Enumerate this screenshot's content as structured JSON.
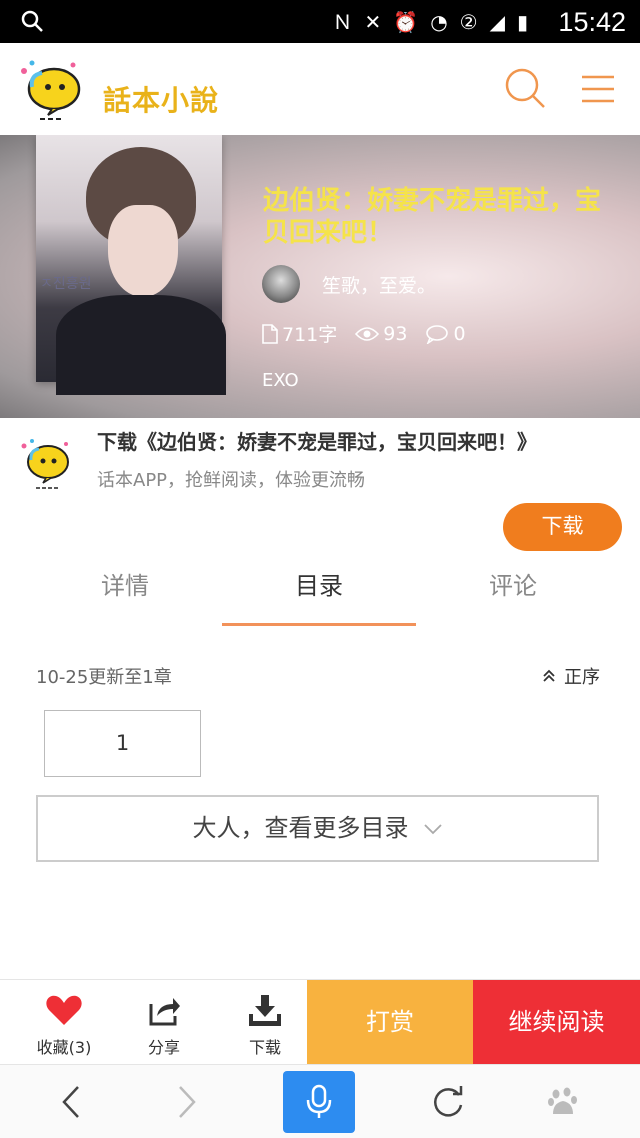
{
  "status_bar": {
    "time": "15:42",
    "icons": [
      "search-icon",
      "nfc-icon",
      "mute-icon",
      "alarm-icon",
      "wifi-icon",
      "sim-2-icon",
      "signal-icon",
      "battery-icon"
    ]
  },
  "header": {
    "logo_text": "話本小說",
    "icons": [
      "search-icon",
      "menu-icon"
    ]
  },
  "book": {
    "title": "边伯贤：娇妻不宠是罪过，宝贝回来吧！",
    "author": "笙歌，至爱。",
    "word_count": "711字",
    "views": "93",
    "comments": "0",
    "tag": "EXO",
    "cover_text": "ㅈ진흥원"
  },
  "promo": {
    "title": "下载《边伯贤：娇妻不宠是罪过，宝贝回来吧！》",
    "subtitle": "话本APP，抢鲜阅读，体验更流畅",
    "download_label": "下载"
  },
  "tabs": [
    {
      "label": "详情",
      "active": false
    },
    {
      "label": "目录",
      "active": true
    },
    {
      "label": "评论",
      "active": false
    }
  ],
  "catalog": {
    "update_text": "10-25更新至1章",
    "order_label": "正序",
    "chapters": [
      "1"
    ],
    "more_label": "大人，查看更多目录"
  },
  "action_bar": {
    "favorite_label": "收藏(3)",
    "share_label": "分享",
    "download_label": "下载",
    "reward_label": "打赏",
    "continue_label": "继续阅读"
  },
  "colors": {
    "accent_orange": "#f07d1e",
    "reward_yellow": "#f8b23f",
    "continue_red": "#ee2f36",
    "title_yellow": "#f5e34a",
    "mic_blue": "#2d8cf0"
  }
}
